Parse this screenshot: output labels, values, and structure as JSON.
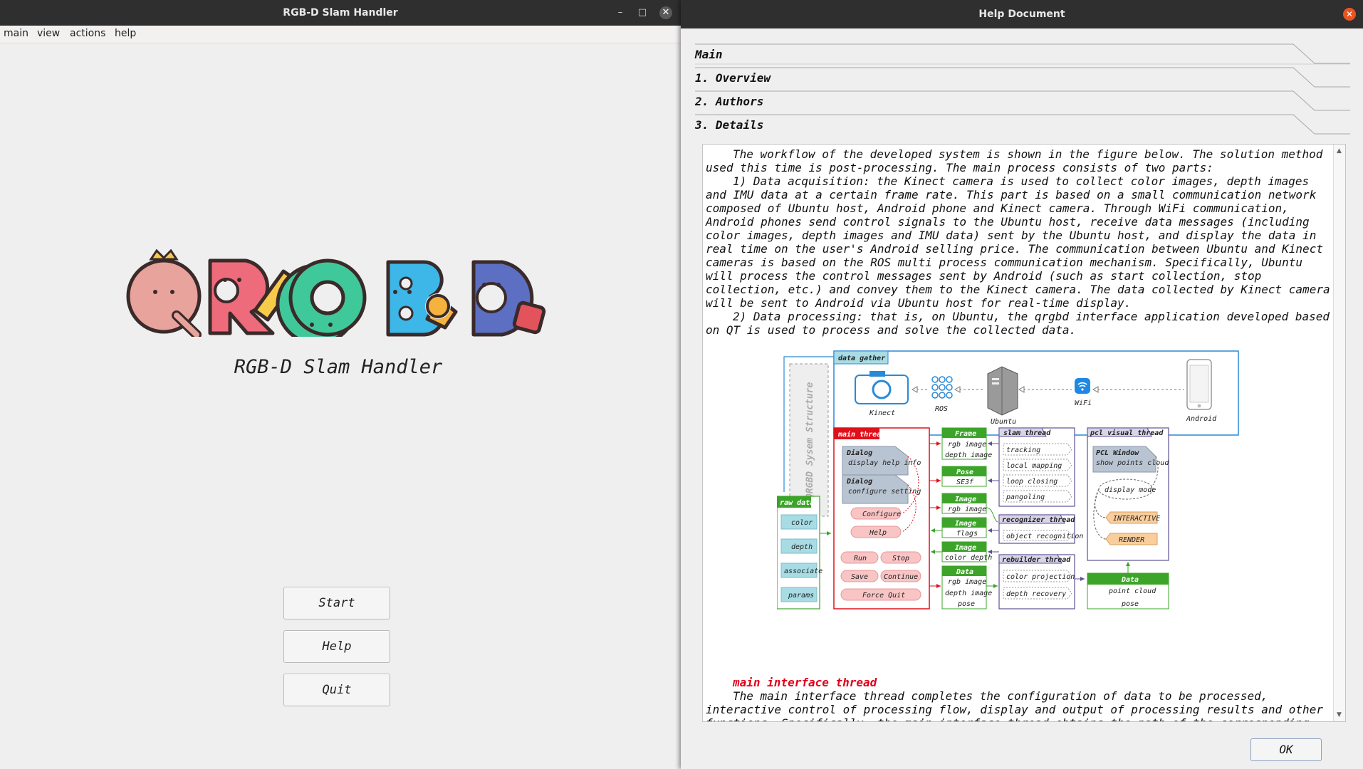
{
  "main_window": {
    "title": "RGB-D Slam Handler",
    "menu": [
      "main",
      "view",
      "actions",
      "help"
    ],
    "logo_letters": [
      "Q",
      "R",
      "G",
      "B",
      "D"
    ],
    "app_name": "RGB-D Slam Handler",
    "buttons": {
      "start": "Start",
      "help": "Help",
      "quit": "Quit"
    }
  },
  "help_window": {
    "title": "Help Document",
    "sections": [
      "Main",
      "1. Overview",
      "2. Authors",
      "3. Details"
    ],
    "paragraphs": [
      "The workflow of the developed system is shown in the figure below. The solution method used this time is post-processing. The main process consists of two parts:",
      "1) Data acquisition: the Kinect camera is used to collect color images, depth images and IMU data at a certain frame rate. This        part is based on a small communication network composed of Ubuntu host, Android phone and Kinect camera. Through WiFi communication, Android phones send control signals to the Ubuntu host, receive data messages (including color images, depth images and IMU data) sent by the Ubuntu host, and display the data in real time on the user's Android selling price. The communication between Ubuntu and Kinect cameras is based on the ROS multi process communication mechanism. Specifically, Ubuntu will process the control messages sent by Android (such as start collection, stop collection, etc.) and convey them to the Kinect camera. The data collected by Kinect camera will be sent to Android via Ubuntu host for real-time display.",
      "2) Data processing: that is, on Ubuntu, the qrgbd interface application developed based on QT is used to process and solve the collected data."
    ],
    "subheading": "main interface thread",
    "paragraph_after": "The main interface thread completes the configuration of data to be processed, interactive control of processing flow, display and output of processing results and other functions. Specifically, the main interface thread obtains the path of the corresponding",
    "ok_button": "OK"
  },
  "diagram": {
    "vertical_label": "QRGBD Sysem Structure",
    "data_gather": {
      "title": "data gather",
      "nodes": [
        "Kinect",
        "ROS",
        "Ubuntu",
        "WiFi",
        "Android"
      ]
    },
    "raw_data": {
      "title": "raw data",
      "items": [
        "color",
        "depth",
        "associate",
        "params"
      ]
    },
    "main_thread": {
      "title": "main thread",
      "dialogs": [
        {
          "title": "Dialog",
          "text": "display help info"
        },
        {
          "title": "Dialog",
          "text": "configure setting"
        }
      ],
      "buttons": [
        "Configure",
        "Help",
        "Run",
        "Stop",
        "Save",
        "Continue",
        "Force Quit"
      ]
    },
    "data_blocks": [
      {
        "title": "Frame",
        "rows": [
          "rgb image",
          "depth image"
        ]
      },
      {
        "title": "Pose",
        "rows": [
          "SE3f"
        ]
      },
      {
        "title": "Image",
        "rows": [
          "rgb image"
        ]
      },
      {
        "title": "Image",
        "rows": [
          "flags"
        ]
      },
      {
        "title": "Image",
        "rows": [
          "color depth"
        ]
      },
      {
        "title": "Data",
        "rows": [
          "rgb image",
          "depth image",
          "pose"
        ]
      }
    ],
    "slam_thread": {
      "title": "slam thread",
      "items": [
        "tracking",
        "local mapping",
        "loop closing",
        "pangoling"
      ]
    },
    "recognizer_thread": {
      "title": "recognizer thread",
      "items": [
        "object recognition"
      ]
    },
    "rebuilder_thread": {
      "title": "rebuilder thread",
      "items": [
        "color projection",
        "depth recovery"
      ]
    },
    "pcl_visual_thread": {
      "title": "pcl visual thread",
      "window": {
        "title": "PCL Window",
        "text": "show points cloud"
      },
      "mode": "display mode",
      "modes": [
        "INTERACTIVE",
        "RENDER"
      ]
    },
    "output_data": {
      "title": "Data",
      "rows": [
        "point cloud",
        "pose"
      ]
    },
    "colors": {
      "green": "#3da42a",
      "red": "#e0101a",
      "blue": "#2a8ad6",
      "purple": "#5d4f94",
      "cyan_box": "#a8dce4",
      "pink_btn": "#f8c4c4",
      "orange_btn": "#f9ce9c"
    }
  }
}
